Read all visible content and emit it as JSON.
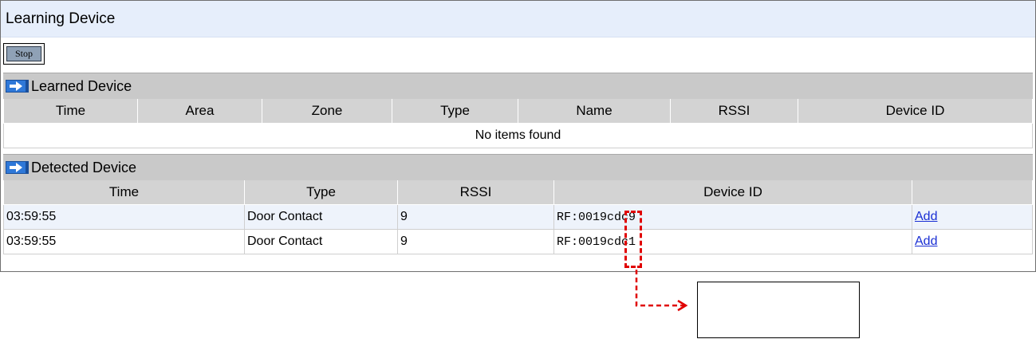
{
  "page": {
    "title": "Learning Device"
  },
  "toolbar": {
    "stop_label": "Stop"
  },
  "learned": {
    "title": "Learned Device",
    "columns": [
      "Time",
      "Area",
      "Zone",
      "Type",
      "Name",
      "RSSI",
      "Device ID"
    ],
    "empty_text": "No items found"
  },
  "detected": {
    "title": "Detected Device",
    "columns": [
      "Time",
      "Type",
      "RSSI",
      "Device ID",
      ""
    ],
    "rows": [
      {
        "time": "03:59:55",
        "type": "Door Contact",
        "rssi": "9",
        "device_id": "RF:0019cdc9",
        "action": "Add"
      },
      {
        "time": "03:59:55",
        "type": "Door Contact",
        "rssi": "9",
        "device_id": "RF:0019cdc1",
        "action": "Add"
      }
    ]
  },
  "annotation": {
    "color": "#e00000"
  },
  "icons": {
    "section": "arrow-right-icon"
  }
}
